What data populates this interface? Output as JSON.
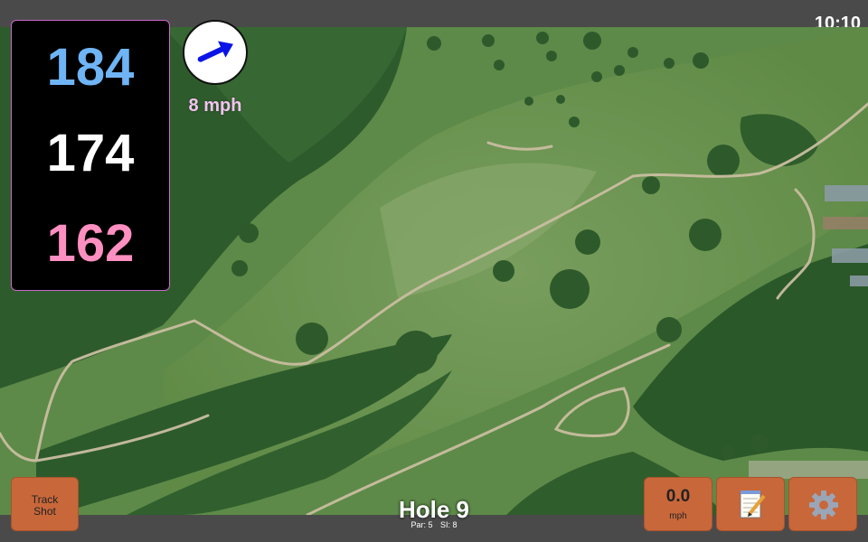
{
  "status": {
    "time": "10:10"
  },
  "distances": {
    "back": "184",
    "middle": "174",
    "front": "162"
  },
  "wind": {
    "speed_label": "8 mph",
    "direction_deg": 65,
    "arrow_color": "#0a14e6"
  },
  "hole": {
    "title": "Hole 9",
    "par_label": "Par: 5",
    "si_label": "SI: 8"
  },
  "buttons": {
    "track_shot_line1": "Track",
    "track_shot_line2": "Shot",
    "speed_value": "0.0",
    "speed_unit": "mph",
    "notes_icon": "notepad-icon",
    "settings_icon": "gear-icon"
  },
  "colors": {
    "button_bg": "#c8673a",
    "back_dist": "#6fb4f5",
    "front_dist": "#ff8fc0",
    "panel_border": "#cc66cc"
  }
}
